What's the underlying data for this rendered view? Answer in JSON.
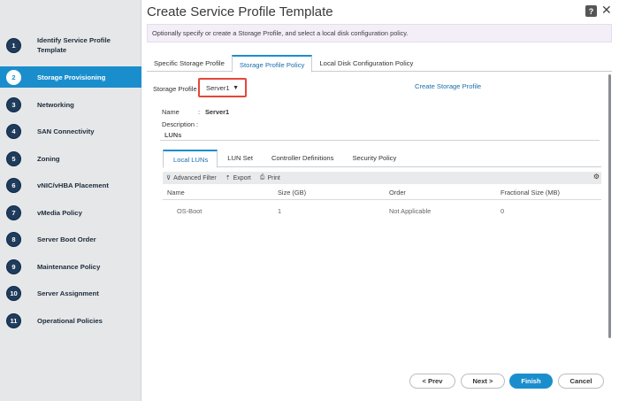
{
  "window": {
    "title": "Create Service Profile Template",
    "help_label": "?",
    "close_label": "✕"
  },
  "sidebar": {
    "items": [
      {
        "num": "1",
        "label": "Identify Service Profile Template"
      },
      {
        "num": "2",
        "label": "Storage Provisioning"
      },
      {
        "num": "3",
        "label": "Networking"
      },
      {
        "num": "4",
        "label": "SAN Connectivity"
      },
      {
        "num": "5",
        "label": "Zoning"
      },
      {
        "num": "6",
        "label": "vNIC/vHBA Placement"
      },
      {
        "num": "7",
        "label": "vMedia Policy"
      },
      {
        "num": "8",
        "label": "Server Boot Order"
      },
      {
        "num": "9",
        "label": "Maintenance Policy"
      },
      {
        "num": "10",
        "label": "Server Assignment"
      },
      {
        "num": "11",
        "label": "Operational Policies"
      }
    ],
    "active_index": 1
  },
  "info": "Optionally specify or create a Storage Profile, and select a local disk configuration policy.",
  "tabs": [
    {
      "label": "Specific Storage Profile"
    },
    {
      "label": "Storage Profile Policy"
    },
    {
      "label": "Local Disk Configuration Policy"
    }
  ],
  "storage_profile": {
    "label": "Storage Profile",
    "value": "Server1",
    "dropdown_icon": "▼",
    "create_link": "Create Storage Profile"
  },
  "details": {
    "name_label": "Name",
    "name_colon": ":",
    "name_value": "Server1",
    "description_label": "Description :",
    "luns_label": "LUNs"
  },
  "sub_tabs": [
    {
      "label": "Local LUNs"
    },
    {
      "label": "LUN Set"
    },
    {
      "label": "Controller Definitions"
    },
    {
      "label": "Security Policy"
    }
  ],
  "toolbar": {
    "filter": "Advanced Filter",
    "export": "Export",
    "print": "Print",
    "filter_icon": "⊽",
    "export_icon": "⇡",
    "print_icon": "⎙",
    "settings_icon": "⚙"
  },
  "table": {
    "columns": [
      "Name",
      "Size (GB)",
      "Order",
      "Fractional Size (MB)"
    ],
    "rows": [
      [
        "OS-Boot",
        "1",
        "Not Applicable",
        "0"
      ]
    ]
  },
  "buttons": {
    "prev": "< Prev",
    "next": "Next >",
    "finish": "Finish",
    "cancel": "Cancel"
  },
  "colors": {
    "accent": "#1a8ecd",
    "highlight_border": "#e4473a",
    "sidebar_bg": "#e6e7e9"
  }
}
